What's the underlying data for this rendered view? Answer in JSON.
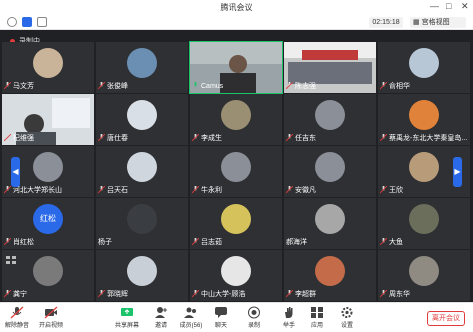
{
  "window": {
    "title": "腾讯会议"
  },
  "topbar": {
    "timer": "02:15:18",
    "view_label": "宫格视图"
  },
  "recording": {
    "label": "录制中"
  },
  "grid": {
    "tiles": [
      {
        "name": "马文芳"
      },
      {
        "name": "张俊峰"
      },
      {
        "name": "Camus"
      },
      {
        "name": "陈志强"
      },
      {
        "name": "俞相华"
      },
      {
        "name": "杞维强"
      },
      {
        "name": "唐仕春"
      },
      {
        "name": "李成生"
      },
      {
        "name": "任吉东"
      },
      {
        "name": "蔡禹龙-东北大学秦皇岛..."
      },
      {
        "name": "河北大学郑长山"
      },
      {
        "name": "吕天石"
      },
      {
        "name": "牛永利"
      },
      {
        "name": "安徽凡"
      },
      {
        "name": "王欣"
      },
      {
        "name": "肖红松",
        "avatar_text": "红松"
      },
      {
        "name": "杨子"
      },
      {
        "name": "吕志茹"
      },
      {
        "name": "郝海洋"
      },
      {
        "name": "大鱼"
      },
      {
        "name": "龚宁"
      },
      {
        "name": "郭晓辉"
      },
      {
        "name": "中山大学-顾浩"
      },
      {
        "name": "李超群"
      },
      {
        "name": "周东华"
      }
    ]
  },
  "toolbar": {
    "items": [
      {
        "label": "解除静音"
      },
      {
        "label": "开启视频"
      },
      {
        "label": "共享屏幕"
      },
      {
        "label": "邀请"
      },
      {
        "label": "成员(56)"
      },
      {
        "label": "聊天"
      },
      {
        "label": "录制"
      },
      {
        "label": "举手"
      },
      {
        "label": "应用"
      },
      {
        "label": "设置"
      }
    ],
    "leave_label": "离开会议"
  },
  "colors": {
    "accent": "#2a6ae8",
    "danger": "#e23b3b",
    "speaking": "#1bc46b"
  }
}
